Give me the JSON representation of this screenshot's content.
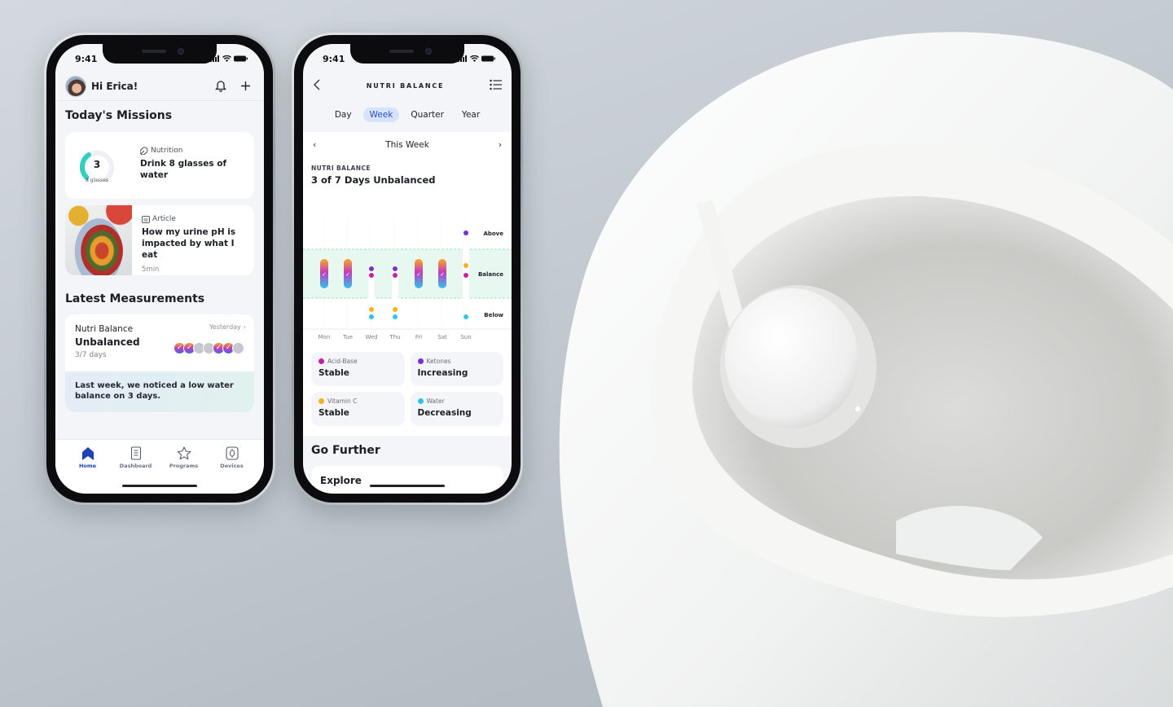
{
  "status_bar": {
    "time": "9:41"
  },
  "home_screen": {
    "greeting": "Hi Erica!",
    "missions_title": "Today's Missions",
    "mission": {
      "category": "Nutrition",
      "title": "Drink 8 glasses of water",
      "progress_value": "3",
      "progress_goal_label": "8 glasses",
      "progress_fraction": 0.375
    },
    "article": {
      "category": "Article",
      "title": "How my urine pH is impacted by what I eat",
      "duration": "5min"
    },
    "measurements_title": "Latest Measurements",
    "measurement": {
      "name": "Nutri Balance",
      "status": "Unbalanced",
      "days": "3/7 days",
      "when": "Yesterday",
      "week_dots": [
        "balanced",
        "balanced",
        "unbalanced",
        "unbalanced",
        "balanced",
        "balanced",
        "unbalanced"
      ],
      "note": "Last week, we noticed a low water balance on 3 days."
    },
    "tabs": [
      {
        "label": "Home",
        "icon": "home-icon",
        "active": true
      },
      {
        "label": "Dashboard",
        "icon": "dashboard-icon",
        "active": false
      },
      {
        "label": "Programs",
        "icon": "star-icon",
        "active": false
      },
      {
        "label": "Devices",
        "icon": "device-icon",
        "active": false
      }
    ]
  },
  "nutri_screen": {
    "title": "NUTRI BALANCE",
    "periods": [
      {
        "label": "Day",
        "active": false
      },
      {
        "label": "Week",
        "active": true
      },
      {
        "label": "Quarter",
        "active": false
      },
      {
        "label": "Year",
        "active": false
      }
    ],
    "range_label": "This Week",
    "summary_kicker": "NUTRI BALANCE",
    "summary_title": "3 of 7 Days Unbalanced",
    "legend": [
      {
        "name": "Acid-Base",
        "trend": "Stable",
        "color": "#c81fa8"
      },
      {
        "name": "Ketones",
        "trend": "Increasing",
        "color": "#7a2fcf"
      },
      {
        "name": "Vitamin C",
        "trend": "Stable",
        "color": "#f7b21b"
      },
      {
        "name": "Water",
        "trend": "Decreasing",
        "color": "#2fc4ee"
      }
    ],
    "go_further_title": "Go Further",
    "explore_label": "Explore"
  },
  "chart_data": {
    "type": "scatter",
    "title": "3 of 7 Days Unbalanced",
    "categories": [
      "Mon",
      "Tue",
      "Wed",
      "Thu",
      "Fri",
      "Sat",
      "Sun"
    ],
    "levels": [
      "Below",
      "Balance",
      "Above"
    ],
    "balanced_days": [
      "Mon",
      "Tue",
      "Fri",
      "Sat"
    ],
    "series": [
      {
        "name": "Acid-Base",
        "color": "#c81fa8",
        "values": [
          "Balance",
          "Balance",
          "Balance",
          "Balance",
          "Balance",
          "Balance",
          "Balance"
        ]
      },
      {
        "name": "Ketones",
        "color": "#7a2fcf",
        "values": [
          "Balance",
          "Balance",
          "Balance",
          "Balance",
          "Balance",
          "Balance",
          "Above"
        ]
      },
      {
        "name": "Vitamin C",
        "color": "#f7b21b",
        "values": [
          "Balance",
          "Balance",
          "Below",
          "Below",
          "Balance",
          "Balance",
          "Balance"
        ]
      },
      {
        "name": "Water",
        "color": "#2fc4ee",
        "values": [
          "Balance",
          "Balance",
          "Below",
          "Below",
          "Balance",
          "Balance",
          "Below"
        ]
      }
    ],
    "grid": true
  }
}
